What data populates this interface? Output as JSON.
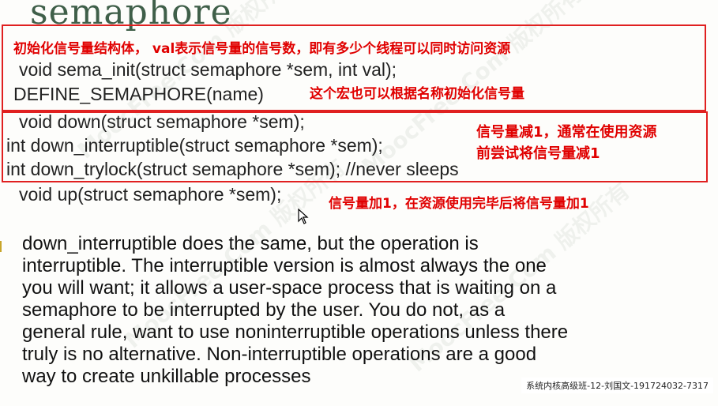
{
  "slide": {
    "title": "semaphore",
    "box1_note": "初始化信号量结构体， val表示信号量的信号数，即有多少个线程可以同时访问资源",
    "code_sema_init": "void sema_init(struct semaphore *sem, int val);",
    "code_define": "DEFINE_SEMAPHORE(name)",
    "define_note": "这个宏也可以根据名称初始化信号量",
    "code_down": "void down(struct semaphore *sem);",
    "code_down_interruptible": "int down_interruptible(struct semaphore *sem);",
    "code_down_trylock": "int down_trylock(struct semaphore *sem); //never sleeps",
    "down_note_line1": "信号量减1，通常在使用资源",
    "down_note_line2": "前尝试将信号量减1",
    "code_up": "void up(struct semaphore *sem);",
    "up_note": "信号量加1，在资源使用完毕后将信号量加1",
    "paragraph_lines": [
      "down_interruptible does the same, but the operation is",
      "interruptible. The interruptible version is almost always the one",
      "you will want; it allows a user-space process that is waiting on a",
      "semaphore to be interrupted by the user. You do not, as a",
      "general rule, want to use noninterruptible operations unless there",
      "truly is no alternative. Non-interruptible operations are a good",
      "way to create unkillable processes"
    ]
  },
  "caption": "系统内核高级班-12-刘国文-191724032-7317",
  "colors": {
    "annotation_red": "#e00000",
    "box_border": "#e02020",
    "title_green": "#3f5f49"
  },
  "icons": {
    "cursor": "mouse-pointer-icon"
  }
}
